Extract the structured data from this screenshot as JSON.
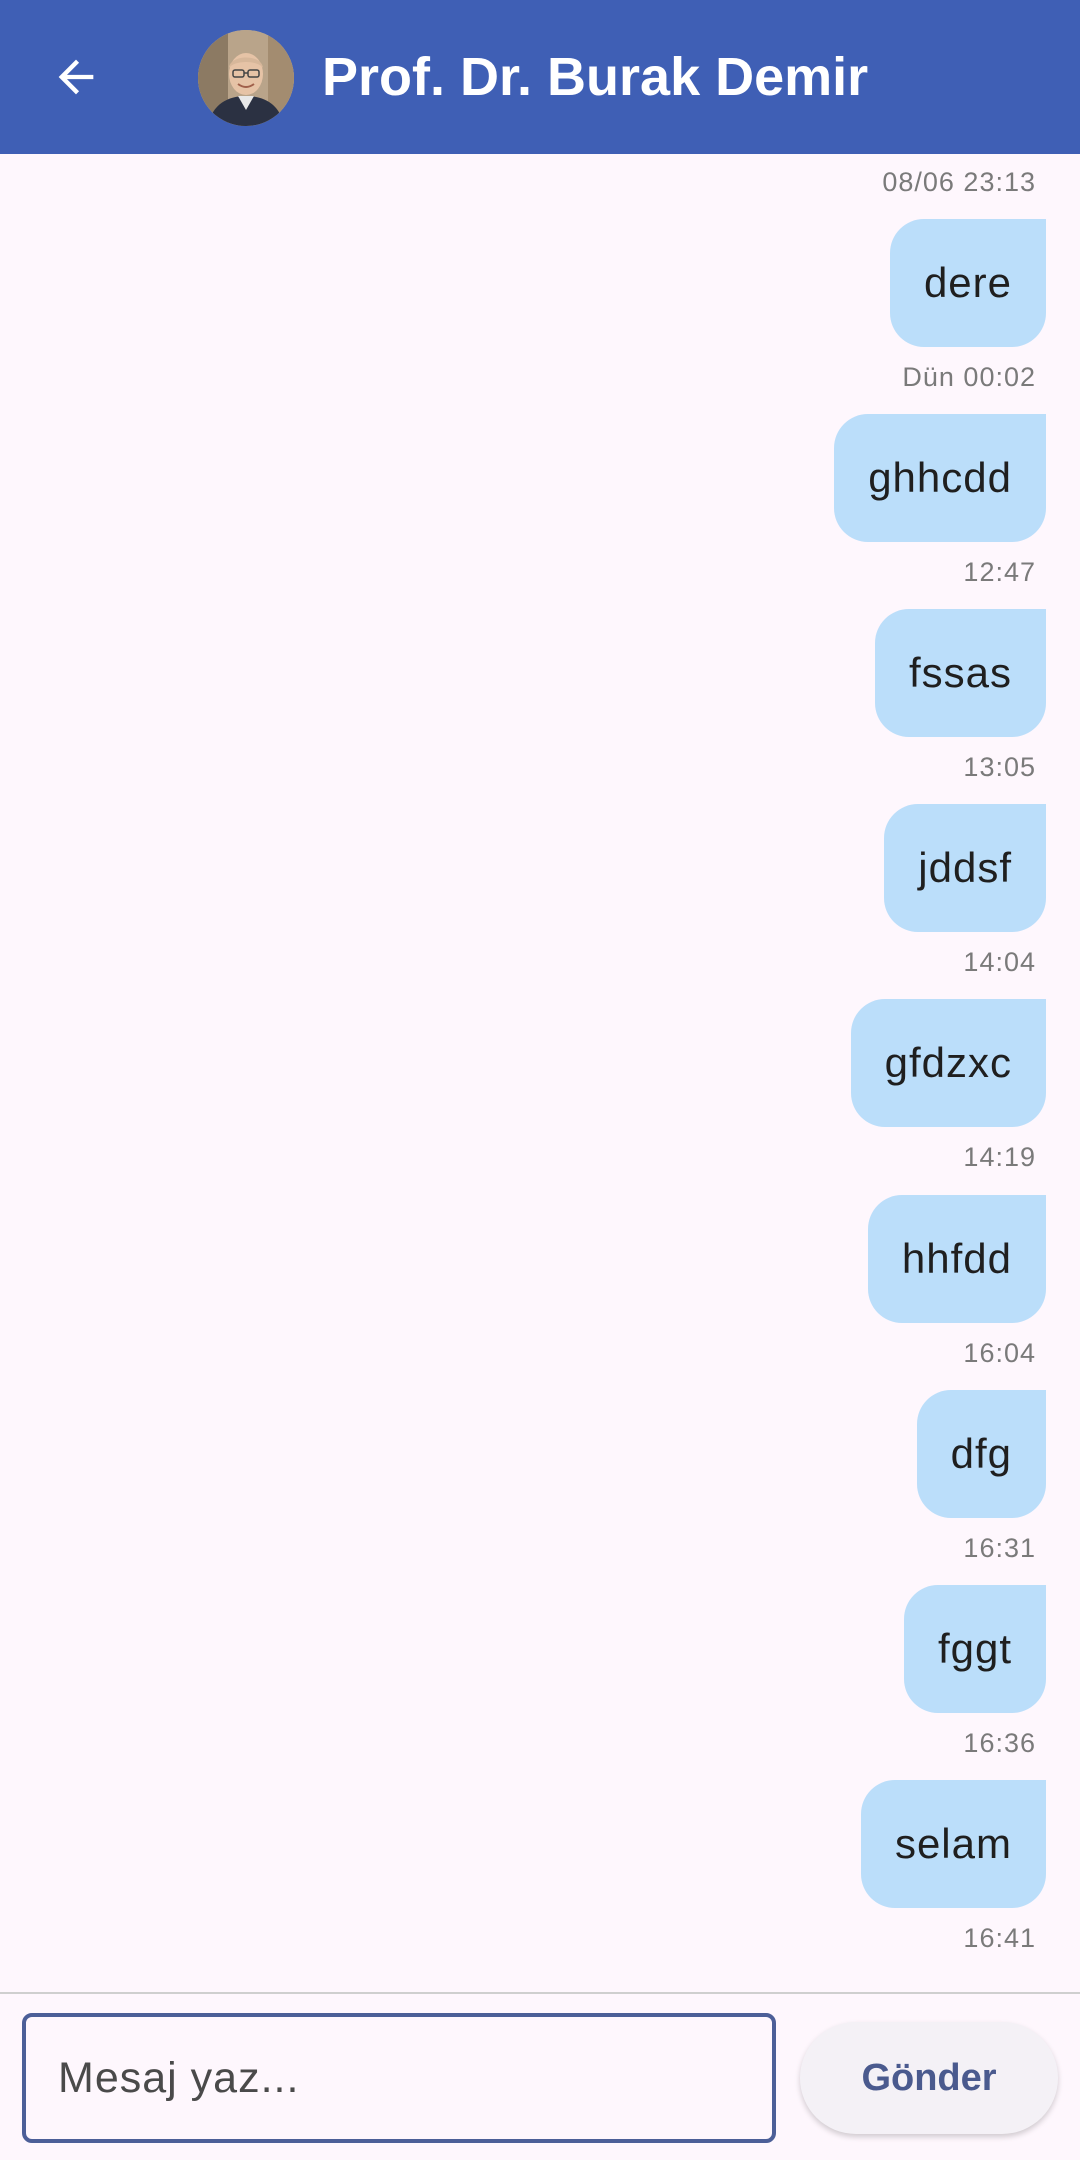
{
  "header": {
    "title": "Prof. Dr. Burak Demir",
    "background": "#3f5fb5",
    "back_icon": "arrow-left-icon",
    "avatar_icon": "profile-photo"
  },
  "messages": [
    {
      "time": "08/06 23:13",
      "text": "dere"
    },
    {
      "time": "Dün 00:02",
      "text": "ghhcdd"
    },
    {
      "time": "12:47",
      "text": "fssas"
    },
    {
      "time": "13:05",
      "text": "jddsf"
    },
    {
      "time": "14:04",
      "text": "gfdzxc"
    },
    {
      "time": "14:19",
      "text": "hhfdd"
    },
    {
      "time": "16:04",
      "text": "dfg"
    },
    {
      "time": "16:31",
      "text": "fggt"
    },
    {
      "time": "16:36",
      "text": "selam"
    },
    {
      "time": "16:41",
      "text": ""
    }
  ],
  "composer": {
    "placeholder": "Mesaj yaz...",
    "value": "",
    "send_label": "Gönder"
  },
  "colors": {
    "bubble": "#bbdefa",
    "background": "#fef7fd",
    "input_border": "#4c5f98"
  }
}
